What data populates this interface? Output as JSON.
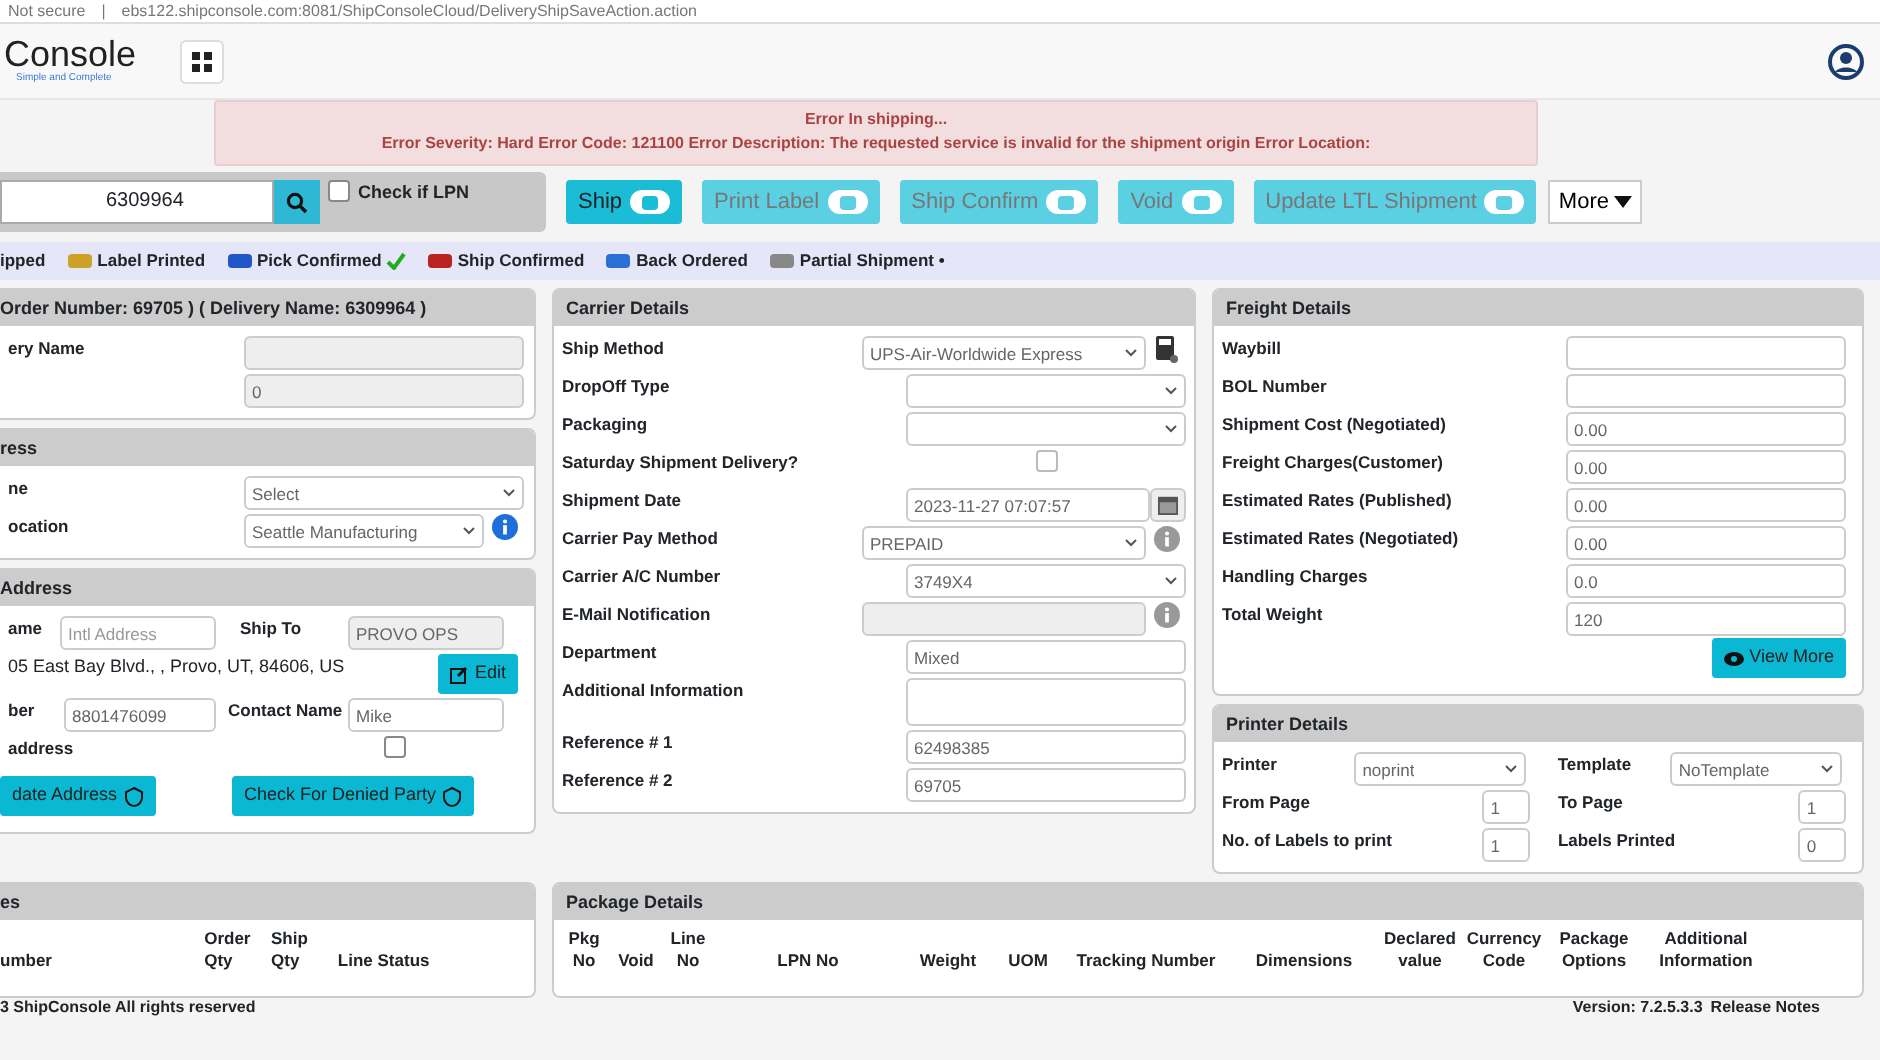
{
  "browser": {
    "security": "Not secure",
    "separator": "|",
    "url": "ebs122.shipconsole.com:8081/ShipConsoleCloud/DeliveryShipSaveAction.action"
  },
  "header": {
    "logo": "Console",
    "tagline": "Simple and Complete"
  },
  "error": {
    "title": "Error In shipping...",
    "message": "Error Severity: Hard Error Code: 121100 Error Description: The requested service is invalid for the shipment origin Error Location:"
  },
  "search": {
    "value": "6309964",
    "lpn_label": "Check if LPN",
    "lpn_checked": false
  },
  "actions": [
    {
      "label": "Ship",
      "disabled": false
    },
    {
      "label": "Print Label",
      "disabled": true
    },
    {
      "label": "Ship Confirm",
      "disabled": true
    },
    {
      "label": "Void",
      "disabled": true
    },
    {
      "label": "Update LTL Shipment",
      "disabled": true
    }
  ],
  "more": "More",
  "legend": [
    {
      "label": "ipped",
      "kind": "none"
    },
    {
      "label": "Label Printed",
      "kind": "label"
    },
    {
      "label": "Pick Confirmed",
      "kind": "pick",
      "tick": true
    },
    {
      "label": "Ship Confirmed",
      "kind": "ship"
    },
    {
      "label": "Back Ordered",
      "kind": "back"
    },
    {
      "label": "Partial Shipment •",
      "kind": "partial"
    }
  ],
  "delivery": {
    "title": "Order Number: 69705 ) ( Delivery Name: 6309964 )",
    "fields": [
      {
        "label": "ery Name"
      },
      {
        "value": "0"
      }
    ]
  },
  "address": {
    "title": "ress",
    "fields": [
      {
        "label": "ne",
        "value": "Select",
        "info": false
      },
      {
        "label": "ocation",
        "value": "Seattle Manufacturing",
        "info": true
      }
    ]
  },
  "ship_to": {
    "title": "Address",
    "name_label": "ame",
    "name_placeholder": "Intl Address",
    "ship_to_label": "Ship To",
    "ship_to_value": "PROVO OPS",
    "address_line": "05 East Bay Blvd., , Provo, UT, 84606, US",
    "edit_button": "Edit",
    "phone_label": "ber",
    "phone_value": "8801476099",
    "contact_label": "Contact Name",
    "contact_value": "Mike",
    "flag_label": "address",
    "flag_checked": false,
    "buttons": [
      "date Address",
      "Check For Denied Party"
    ]
  },
  "carrier": {
    "title": "Carrier Details",
    "fields": [
      {
        "label": "Ship Method",
        "kind": "select",
        "value": "UPS-Air-Worldwide Express"
      },
      {
        "label": "DropOff Type",
        "kind": "select"
      },
      {
        "label": "Packaging",
        "kind": "select"
      },
      {
        "label": "Saturday Shipment Delivery?",
        "kind": "checkbox",
        "checked": false
      },
      {
        "label": "Shipment Date",
        "kind": "date",
        "value": "2023-11-27 07:07:57"
      },
      {
        "label": "Carrier Pay Method",
        "kind": "select",
        "value": "PREPAID"
      },
      {
        "label": "Carrier A/C Number",
        "kind": "select",
        "value": "3749X4"
      },
      {
        "label": "E-Mail Notification",
        "kind": "readonly"
      },
      {
        "label": "Department",
        "kind": "text",
        "value": "Mixed"
      },
      {
        "label": "Additional Information",
        "kind": "textarea"
      },
      {
        "label": "Reference # 1",
        "kind": "text",
        "value": "62498385"
      },
      {
        "label": "Reference # 2",
        "kind": "text",
        "value": "69705"
      }
    ]
  },
  "freight": {
    "title": "Freight Details",
    "fields": [
      {
        "label": "Waybill"
      },
      {
        "label": "BOL Number"
      },
      {
        "label": "Shipment Cost (Negotiated)",
        "value": "0.00"
      },
      {
        "label": "Freight Charges(Customer)",
        "value": "0.00"
      },
      {
        "label": "Estimated Rates (Published)",
        "value": "0.00"
      },
      {
        "label": "Estimated Rates (Negotiated)",
        "value": "0.00"
      },
      {
        "label": "Handling Charges",
        "value": "0.0"
      },
      {
        "label": "Total Weight",
        "value": "120"
      }
    ],
    "button": "View More"
  },
  "printer": {
    "title": "Printer Details",
    "rows": [
      [
        {
          "label": "Printer",
          "kind": "select",
          "value": "noprint"
        },
        {
          "label": "Template",
          "kind": "select",
          "value": "NoTemplate"
        }
      ],
      [
        {
          "label": "From Page",
          "kind": "text",
          "value": "1"
        },
        {
          "label": "To Page",
          "kind": "text",
          "value": "1"
        }
      ],
      [
        {
          "label": "No. of Labels to print",
          "kind": "text",
          "value": "1"
        },
        {
          "label": "Labels Printed",
          "kind": "text",
          "value": "0"
        }
      ]
    ]
  },
  "lines": {
    "title": "es",
    "columns": [
      "umber",
      "Order Qty",
      "Ship Qty",
      "Line Status"
    ]
  },
  "packages": {
    "title": "Package Details",
    "columns": [
      "Pkg No",
      "Void",
      "Line No",
      "LPN No",
      "Weight",
      "UOM",
      "Tracking Number",
      "Dimensions",
      "Declared value",
      "Currency Code",
      "Package Options",
      "Additional Information"
    ]
  },
  "footer": {
    "copyright": "3 ShipConsole All rights reserved",
    "version": "Version: 7.2.5.3.3",
    "release_notes": "Release Notes"
  }
}
